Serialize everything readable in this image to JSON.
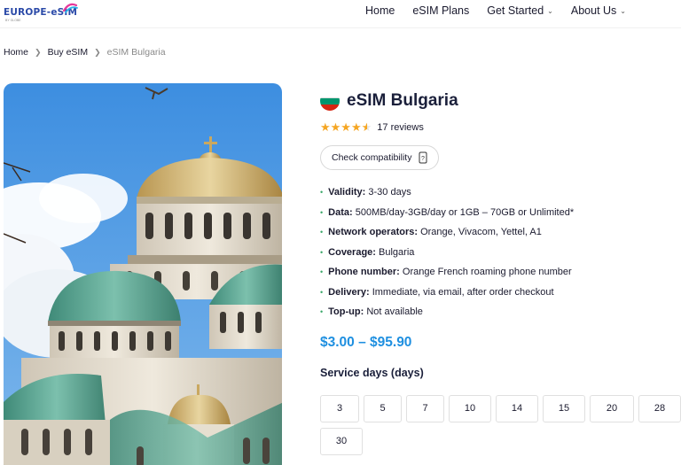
{
  "header": {
    "logo_text": "EUROPE-eSIM",
    "logo_sub": "BY GLOBE",
    "nav": [
      {
        "label": "Home",
        "has_dropdown": false
      },
      {
        "label": "eSIM Plans",
        "has_dropdown": false
      },
      {
        "label": "Get Started",
        "has_dropdown": true
      },
      {
        "label": "About Us",
        "has_dropdown": true
      }
    ]
  },
  "breadcrumb": {
    "items": [
      "Home",
      "Buy eSIM",
      "eSIM Bulgaria"
    ]
  },
  "product": {
    "title": "eSIM Bulgaria",
    "flag_colors": [
      "#ffffff",
      "#00966e",
      "#d62612"
    ],
    "rating": 4.5,
    "reviews": "17 reviews",
    "compat_label": "Check compatibility",
    "compat_icon": "phone-icon",
    "features": [
      {
        "label": "Validity:",
        "value": "3-30 days"
      },
      {
        "label": "Data:",
        "value": "500MB/day-3GB/day or 1GB – 70GB or Unlimited*"
      },
      {
        "label": "Network operators:",
        "value": "Orange, Vivacom, Yettel, A1"
      },
      {
        "label": "Coverage:",
        "value": "Bulgaria"
      },
      {
        "label": "Phone number:",
        "value": "Orange French roaming phone number"
      },
      {
        "label": "Delivery:",
        "value": "Immediate, via email, after order checkout"
      },
      {
        "label": "Top-up:",
        "value": "Not available"
      }
    ],
    "price": "$3.00 – $95.90",
    "service_title": "Service days (days)",
    "service_days": [
      "3",
      "5",
      "7",
      "10",
      "14",
      "15",
      "20",
      "28",
      "30"
    ]
  },
  "colors": {
    "accent": "#1e8fe0",
    "star": "#f5a623",
    "bullet": "#3ba86a"
  }
}
